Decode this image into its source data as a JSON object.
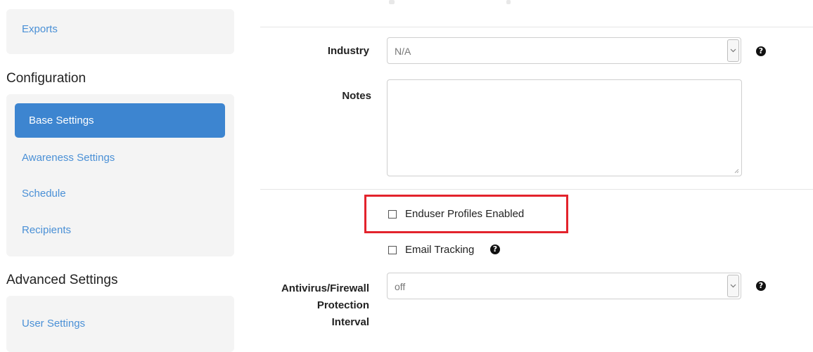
{
  "sidebar": {
    "exports_label": "Exports",
    "configuration_title": "Configuration",
    "configuration_items": [
      {
        "label": "Base Settings",
        "active": true
      },
      {
        "label": "Awareness Settings"
      },
      {
        "label": "Schedule"
      },
      {
        "label": "Recipients"
      }
    ],
    "advanced_title": "Advanced Settings",
    "advanced_items": [
      {
        "label": "User Settings"
      }
    ]
  },
  "form": {
    "industry": {
      "label": "Industry",
      "value": "N/A",
      "help_icon": "question-circle-icon"
    },
    "notes": {
      "label": "Notes",
      "value": ""
    },
    "enduser_profiles": {
      "label": "Enduser Profiles Enabled",
      "checked": false
    },
    "email_tracking": {
      "label": "Email Tracking",
      "checked": false,
      "help_icon": "question-circle-icon"
    },
    "antivirus": {
      "label_lines": [
        "Antivirus/Firewall",
        "Protection",
        "Interval"
      ],
      "value": "off",
      "help_icon": "question-circle-icon"
    }
  },
  "colors": {
    "accent": "#3d85d0",
    "link": "#4a90d6",
    "highlight_border": "#e3232c"
  },
  "icons": {
    "help": "?"
  }
}
